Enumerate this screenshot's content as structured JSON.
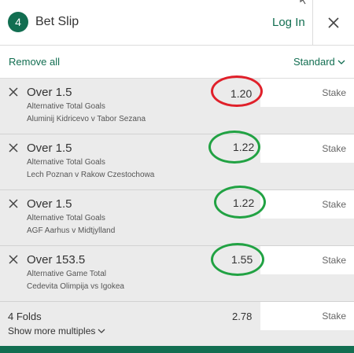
{
  "header": {
    "count": "4",
    "title": "Bet Slip",
    "login_label": "Log In",
    "close_icon": "close-icon"
  },
  "toolbar": {
    "remove_all_label": "Remove all",
    "bet_type_label": "Standard"
  },
  "bets": [
    {
      "selection": "Over 1.5",
      "market": "Alternative Total Goals",
      "event": "Aluminij Kidricevo v Tabor Sezana",
      "odds": "1.20",
      "stake_placeholder": "Stake",
      "highlight": "red"
    },
    {
      "selection": "Over 1.5",
      "market": "Alternative Total Goals",
      "event": "Lech Poznan v Rakow Czestochowa",
      "odds": "1.22",
      "stake_placeholder": "Stake",
      "highlight": "green"
    },
    {
      "selection": "Over 1.5",
      "market": "Alternative Total Goals",
      "event": "AGF Aarhus v Midtjylland",
      "odds": "1.22",
      "stake_placeholder": "Stake",
      "highlight": "green"
    },
    {
      "selection": "Over 153.5",
      "market": "Alternative Game Total",
      "event": "Cedevita Olimpija vs Igokea",
      "odds": "1.55",
      "stake_placeholder": "Stake",
      "highlight": "green"
    }
  ],
  "multiples": {
    "label": "4 Folds",
    "odds": "2.78",
    "stake_placeholder": "Stake",
    "show_more_label": "Show more multiples"
  },
  "colors": {
    "brand_green": "#126e51",
    "row_background": "#ebebeb",
    "annotation_red": "#e0202a",
    "annotation_green": "#21a243"
  }
}
